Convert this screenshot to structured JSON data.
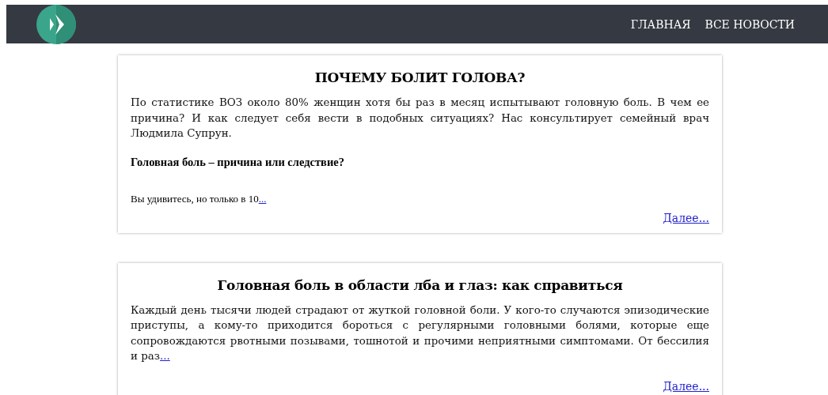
{
  "nav": {
    "items": [
      {
        "label": "ГЛАВНАЯ"
      },
      {
        "label": "ВСЕ НОВОСТИ"
      }
    ]
  },
  "articles": [
    {
      "title": "ПОЧЕМУ БОЛИТ ГОЛОВА?",
      "blocks": [
        {
          "kind": "para",
          "text": "По статистике ВОЗ около 80% женщин хотя бы раз в месяц испытывают головную боль. В чем ее причина? И как следует себя вести в подобных ситуациях? Нас консультирует семейный врач Людмила Супрун."
        },
        {
          "kind": "subhead",
          "text": "Головная боль – причина или следствие?"
        },
        {
          "kind": "small",
          "text": "Вы удивитесь, но только в 10",
          "link": "..."
        }
      ],
      "more": "Далее..."
    },
    {
      "title": "Головная боль в области лба и глаз: как справиться",
      "blocks": [
        {
          "kind": "para",
          "text": "Каждый день тысячи людей страдают от жуткой головной боли. У кого-то случаются эпизодические приступы, а кому-то приходится бороться с регулярными головными болями, которые еще сопровождаются рвотными позывами, тошнотой и прочими неприятными симптомами. От бессилия и раз",
          "link": "..."
        }
      ],
      "more": "Далее..."
    }
  ]
}
